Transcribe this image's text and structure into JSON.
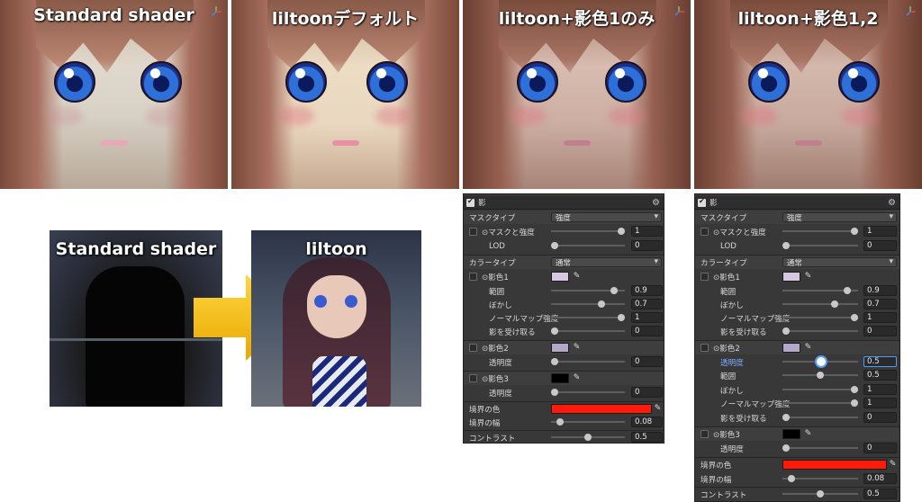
{
  "renders": [
    {
      "title": "Standard shader"
    },
    {
      "title": "liltoonデフォルト"
    },
    {
      "title": "liltoon+影色1のみ"
    },
    {
      "title": "liltoon+影色1,2"
    }
  ],
  "comparison": {
    "left_label": "Standard shader",
    "right_label": "liltoon"
  },
  "panel1": {
    "header": "影",
    "rows": {
      "mask_type": {
        "label": "マスクタイプ",
        "value": "強度"
      },
      "mask_strength": {
        "label": "⊙マスクと強度",
        "value": "1"
      },
      "lod": {
        "label": "LOD",
        "value": "0"
      },
      "color_type": {
        "label": "カラータイプ",
        "value": "通常"
      },
      "shadow1": {
        "label": "⊙影色1"
      },
      "range1": {
        "label": "範囲",
        "value": "0.9"
      },
      "blur1": {
        "label": "ぼかし",
        "value": "0.7"
      },
      "normal1": {
        "label": "ノーマルマップ強度",
        "value": "1"
      },
      "receive1": {
        "label": "影を受け取る",
        "value": "0"
      },
      "shadow2": {
        "label": "⊙影色2"
      },
      "alpha2": {
        "label": "透明度",
        "value": "0"
      },
      "shadow3": {
        "label": "⊙影色3"
      },
      "alpha3": {
        "label": "透明度",
        "value": "0"
      },
      "border_color": {
        "label": "境界の色"
      },
      "border_width": {
        "label": "境界の幅",
        "value": "0.08"
      },
      "contrast": {
        "label": "コントラスト",
        "value": "0.5"
      }
    }
  },
  "panel2": {
    "header": "影",
    "rows": {
      "mask_type": {
        "label": "マスクタイプ",
        "value": "強度"
      },
      "mask_strength": {
        "label": "⊙マスクと強度",
        "value": "1"
      },
      "lod": {
        "label": "LOD",
        "value": "0"
      },
      "color_type": {
        "label": "カラータイプ",
        "value": "通常"
      },
      "shadow1": {
        "label": "⊙影色1"
      },
      "range1": {
        "label": "範囲",
        "value": "0.9"
      },
      "blur1": {
        "label": "ぼかし",
        "value": "0.7"
      },
      "normal1": {
        "label": "ノーマルマップ強度",
        "value": "1"
      },
      "receive1": {
        "label": "影を受け取る",
        "value": "0"
      },
      "shadow2": {
        "label": "⊙影色2"
      },
      "alpha2": {
        "label": "透明度",
        "value": "0.5"
      },
      "range2": {
        "label": "範囲",
        "value": "0.5"
      },
      "blur2": {
        "label": "ぼかし",
        "value": "1"
      },
      "normal2": {
        "label": "ノーマルマップ強度",
        "value": "1"
      },
      "receive2": {
        "label": "影を受け取る",
        "value": "0"
      },
      "shadow3": {
        "label": "⊙影色3"
      },
      "alpha3": {
        "label": "透明度",
        "value": "0"
      },
      "border_color": {
        "label": "境界の色"
      },
      "border_width": {
        "label": "境界の幅",
        "value": "0.08"
      },
      "contrast": {
        "label": "コントラスト",
        "value": "0.5"
      }
    }
  },
  "colors": {
    "shadow1": "#d6c6e0",
    "shadow2": "#b3a8cc",
    "shadow3": "#000000",
    "border": "#ff1a0a",
    "arrow": "#f2b400"
  }
}
